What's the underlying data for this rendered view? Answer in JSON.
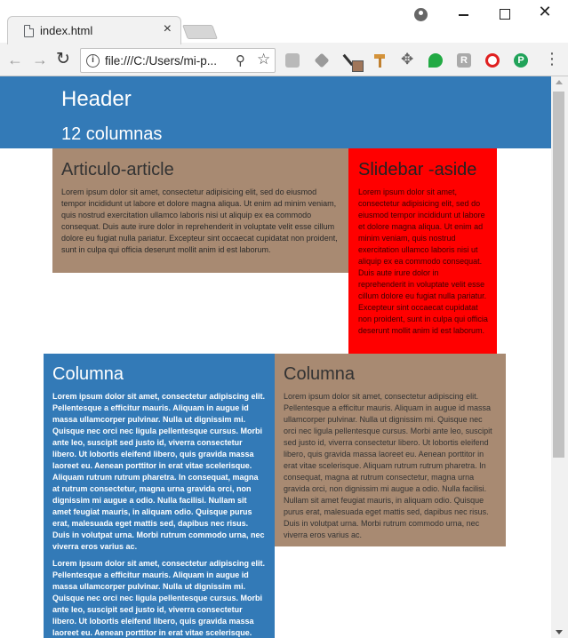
{
  "browser": {
    "tab_title": "index.html",
    "tab_close": "×",
    "url": "file:///C:/Users/mi-p..."
  },
  "page": {
    "header_title": "Header",
    "header_subtitle": "12 columnas",
    "article": {
      "title": "Articulo-article",
      "text": "Lorem ipsum dolor sit amet, consectetur adipisicing elit, sed do eiusmod tempor incididunt ut labore et dolore magna aliqua. Ut enim ad minim veniam, quis nostrud exercitation ullamco laboris nisi ut aliquip ex ea commodo consequat. Duis aute irure dolor in reprehenderit in voluptate velit esse cillum dolore eu fugiat nulla pariatur. Excepteur sint occaecat cupidatat non proident, sunt in culpa qui officia deserunt mollit anim id est laborum."
    },
    "aside": {
      "title": "Slidebar -aside",
      "text": "Lorem ipsum dolor sit amet, consectetur adipisicing elit, sed do eiusmod tempor incididunt ut labore et dolore magna aliqua. Ut enim ad minim veniam, quis nostrud exercitation ullamco laboris nisi ut aliquip ex ea commodo consequat. Duis aute irure dolor in reprehenderit in voluptate velit esse cillum dolore eu fugiat nulla pariatur. Excepteur sint occaecat cupidatat non proident, sunt in culpa qui officia deserunt mollit anim id est laborum."
    },
    "column1": {
      "title": "Columna",
      "paragraph1": "Lorem ipsum dolor sit amet, consectetur adipiscing elit. Pellentesque a efficitur mauris. Aliquam in augue id massa ullamcorper pulvinar. Nulla ut dignissim mi. Quisque nec orci nec ligula pellentesque cursus. Morbi ante leo, suscipit sed justo id, viverra consectetur libero. Ut lobortis eleifend libero, quis gravida massa laoreet eu. Aenean porttitor in erat vitae scelerisque. Aliquam rutrum rutrum pharetra. In consequat, magna at rutrum consectetur, magna urna gravida orci, non dignissim mi augue a odio. Nulla facilisi. Nullam sit amet feugiat mauris, in aliquam odio. Quisque purus erat, malesuada eget mattis sed, dapibus nec risus. Duis in volutpat urna. Morbi rutrum commodo urna, nec viverra eros varius ac.",
      "paragraph2": "Lorem ipsum dolor sit amet, consectetur adipiscing elit. Pellentesque a efficitur mauris. Aliquam in augue id massa ullamcorper pulvinar. Nulla ut dignissim mi. Quisque nec orci nec ligula pellentesque cursus. Morbi ante leo, suscipit sed justo id, viverra consectetur libero. Ut lobortis eleifend libero, quis gravida massa laoreet eu. Aenean porttitor in erat vitae scelerisque. Aliquam rutrum rutrum pharetra. In consequat, magna at rutrum"
    },
    "column2": {
      "title": "Columna",
      "text": "Lorem ipsum dolor sit amet, consectetur adipiscing elit. Pellentesque a efficitur mauris. Aliquam in augue id massa ullamcorper pulvinar. Nulla ut dignissim mi. Quisque nec orci nec ligula pellentesque cursus. Morbi ante leo, suscipit sed justo id, viverra consectetur libero. Ut lobortis eleifend libero, quis gravida massa laoreet eu. Aenean porttitor in erat vitae scelerisque. Aliquam rutrum rutrum pharetra. In consequat, magna at rutrum consectetur, magna urna gravida orci, non dignissim mi augue a odio. Nulla facilisi. Nullam sit amet feugiat mauris, in aliquam odio. Quisque purus erat, malesuada eget mattis sed, dapibus nec risus. Duis in volutpat urna. Morbi rutrum commodo urna, nec viverra eros varius ac."
    }
  },
  "colors": {
    "header_blue": "#337ab7",
    "article_brown": "#a88a72",
    "aside_red": "#ff0000"
  },
  "icons": [
    "document-icon",
    "close-icon",
    "profile-icon",
    "minimize-icon",
    "maximize-icon",
    "back-icon",
    "forward-icon",
    "reload-icon",
    "info-icon",
    "zoom-icon",
    "star-icon",
    "menu-icon"
  ]
}
